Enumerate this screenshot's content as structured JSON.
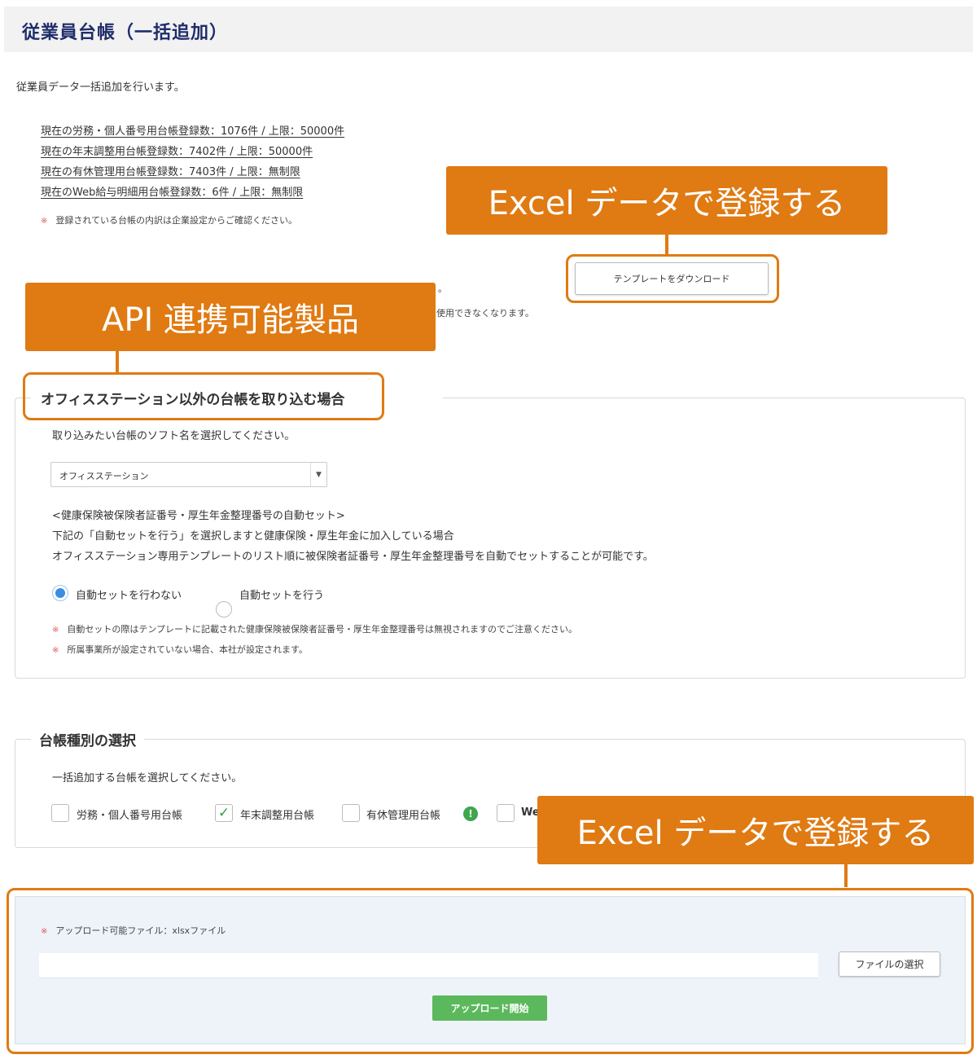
{
  "header": {
    "title": "従業員台帳（一括追加）"
  },
  "intro": "従業員データ一括追加を行います。",
  "counts": [
    "現在の労務・個人番号用台帳登録数：1076件 / 上限：50000件",
    "現在の年末調整用台帳登録数：7402件 / 上限：50000件",
    "現在の有休管理用台帳登録数：7403件 / 上限：無制限",
    "現在のWeb給与明細用台帳登録数：6件 / 上限：無制限"
  ],
  "counts_note": "登録されている台帳の内訳は企業設定からご確認ください。",
  "partial_texts": {
    "period": "。",
    "unusable": "使用できなくなります。"
  },
  "template_button": "テンプレートをダウンロード",
  "callouts": {
    "excel_top": "Excel データで登録する",
    "api": "API 連携可能製品",
    "excel_bottom": "Excel データで登録する"
  },
  "other_ledger": {
    "legend": "オフィスステーション以外の台帳を取り込む場合",
    "instruction": "取り込みたい台帳のソフト名を選択してください。",
    "select_value": "オフィスステーション",
    "auto_heading": "<健康保険被保険者証番号・厚生年金整理番号の自動セット>",
    "auto_line1": "下記の「自動セットを行う」を選択しますと健康保険・厚生年金に加入している場合",
    "auto_line2": "オフィスステーション専用テンプレートのリスト順に被保険者証番号・厚生年金整理番号を自動でセットすることが可能です。",
    "radio_off": "自動セットを行わない",
    "radio_on": "自動セットを行う",
    "note1": "自動セットの際はテンプレートに記載された健康保険被保険者証番号・厚生年金整理番号は無視されますのでご注意ください。",
    "note2": "所属事業所が設定されていない場合、本社が設定されます。"
  },
  "ledger_type": {
    "legend": "台帳種別の選択",
    "instruction": "一括追加する台帳を選択してください。",
    "options": [
      {
        "label": "労務・個人番号用台帳",
        "checked": false
      },
      {
        "label": "年末調整用台帳",
        "checked": true
      },
      {
        "label": "有休管理用台帳",
        "checked": false
      },
      {
        "label": "We",
        "checked": false
      }
    ],
    "info_icon": "!"
  },
  "upload": {
    "note": "アップロード可能ファイル：xlsxファイル",
    "file_button": "ファイルの選択",
    "start_button": "アップロード開始"
  },
  "note_mark": "※",
  "colors": {
    "accent": "#e07a12",
    "title": "#1f2d6b",
    "radio": "#3b8de0",
    "green": "#5cb85c"
  }
}
